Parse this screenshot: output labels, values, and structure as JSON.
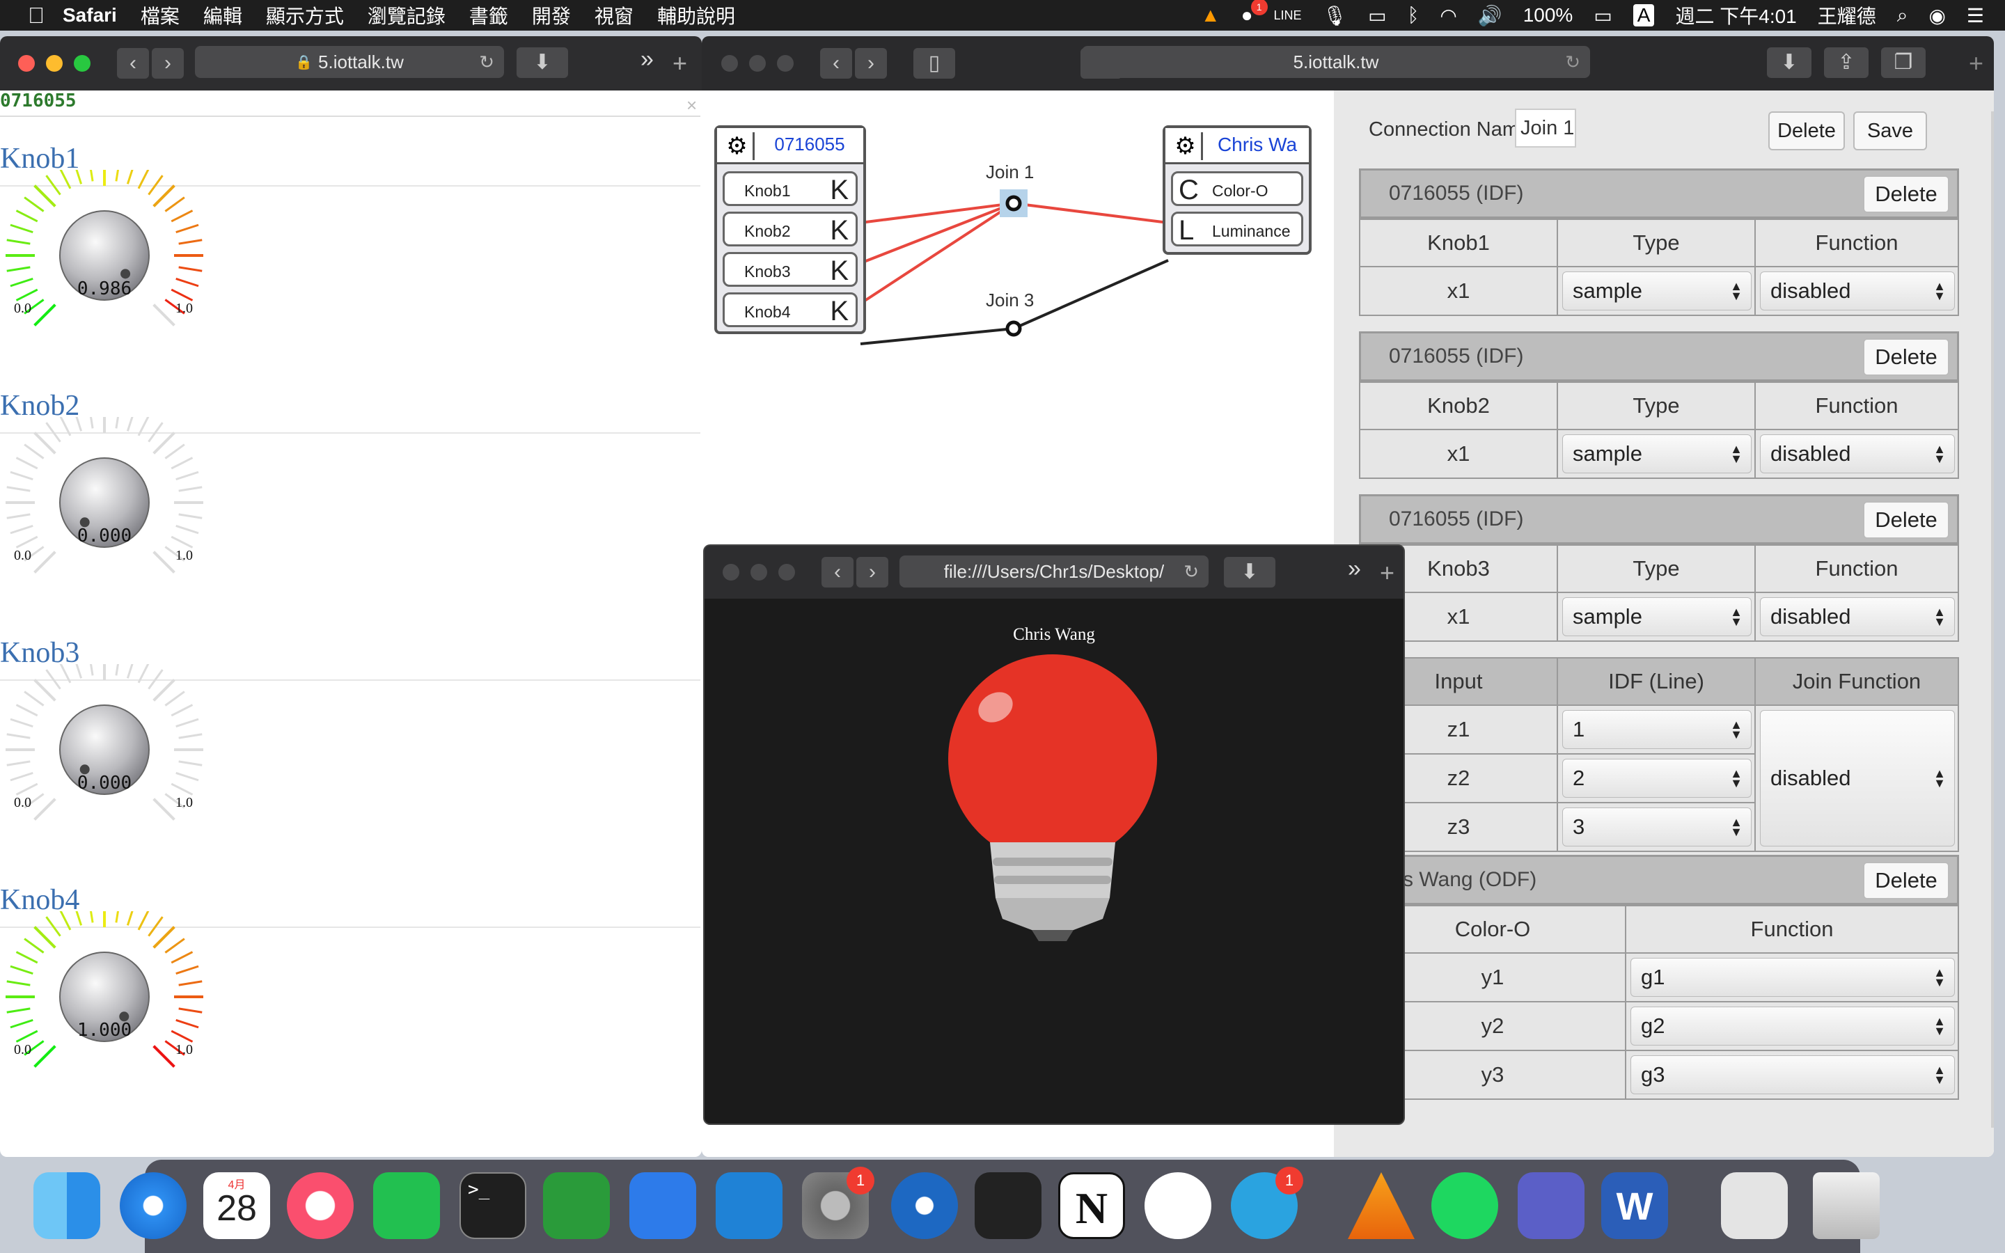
{
  "menubar": {
    "apple_icon": "apple-icon",
    "app_name": "Safari",
    "items": [
      "檔案",
      "編輯",
      "顯示方式",
      "瀏覽記錄",
      "書籤",
      "開發",
      "視窗",
      "輔助說明"
    ],
    "battery": "100%",
    "input_method": "A",
    "datetime": "週二 下午4:01",
    "user": "王耀德",
    "notification_badge": "1"
  },
  "left_window": {
    "url": "5.iottalk.tw",
    "device_name": "0716055",
    "close_symbol": "×",
    "knobs": [
      {
        "label": "Knob1",
        "value": "0.986",
        "level": 0.986,
        "min": "0.0",
        "max": "1.0"
      },
      {
        "label": "Knob2",
        "value": "0.000",
        "level": 0.0,
        "min": "0.0",
        "max": "1.0"
      },
      {
        "label": "Knob3",
        "value": "0.000",
        "level": 0.0,
        "min": "0.0",
        "max": "1.0"
      },
      {
        "label": "Knob4",
        "value": "1.000",
        "level": 1.0,
        "min": "0.0",
        "max": "1.0"
      }
    ]
  },
  "main_window": {
    "url": "5.iottalk.tw",
    "graph": {
      "idf_device": "0716055",
      "idf_features": [
        {
          "name": "Knob1",
          "letter": "K"
        },
        {
          "name": "Knob2",
          "letter": "K"
        },
        {
          "name": "Knob3",
          "letter": "K"
        },
        {
          "name": "Knob4",
          "letter": "K"
        }
      ],
      "odf_device": "Chris Wa",
      "odf_features": [
        {
          "name": "Color-O",
          "letter": "C"
        },
        {
          "name": "Luminance",
          "letter": "L"
        }
      ],
      "joins": [
        "Join 1",
        "Join 3"
      ],
      "colors": {
        "join1": "#e8473e",
        "join3": "#222222"
      }
    },
    "panel": {
      "connection_name_label": "Connection Name:",
      "connection_name_value": "Join 1",
      "delete_label": "Delete",
      "save_label": "Save",
      "idf_sections": [
        {
          "title": "0716055 (IDF)",
          "feature": "Knob1",
          "type_header": "Type",
          "function_header": "Function",
          "var": "x1",
          "type": "sample",
          "function": "disabled"
        },
        {
          "title": "0716055 (IDF)",
          "feature": "Knob2",
          "type_header": "Type",
          "function_header": "Function",
          "var": "x1",
          "type": "sample",
          "function": "disabled"
        },
        {
          "title": "0716055 (IDF)",
          "feature": "Knob3",
          "type_header": "Type",
          "function_header": "Function",
          "var": "x1",
          "type": "sample",
          "function": "disabled"
        }
      ],
      "join": {
        "headers": [
          "Input",
          "IDF (Line)",
          "Join Function"
        ],
        "rows": [
          {
            "input": "z1",
            "line": "1"
          },
          {
            "input": "z2",
            "line": "2"
          },
          {
            "input": "z3",
            "line": "3"
          }
        ],
        "function": "disabled"
      },
      "odf": {
        "title": "s Wang (ODF)",
        "feature_header": "Color-O",
        "function_header": "Function",
        "rows": [
          {
            "var": "y1",
            "function": "g1"
          },
          {
            "var": "y2",
            "function": "g2"
          },
          {
            "var": "y3",
            "function": "g3"
          }
        ]
      }
    }
  },
  "bulb_window": {
    "url": "file:///Users/Chr1s/Desktop/",
    "title": "Chris Wang",
    "bulb_color": "#e53326"
  },
  "dock": {
    "items": [
      "finder-icon",
      "safari-icon",
      "calendar-icon",
      "music-icon",
      "line-icon",
      "terminal-icon",
      "vim-icon",
      "xcode-icon",
      "vscode-icon",
      "system-preferences-icon",
      "voice-memos-icon",
      "piano-icon",
      "notion-icon",
      "slack-icon",
      "telegram-icon",
      "vlc-icon",
      "spotify-icon",
      "teams-icon",
      "word-icon",
      "documents-icon",
      "trash-icon"
    ],
    "calendar_month": "4月",
    "calendar_day": "28",
    "sysprefs_badge": "1",
    "telegram_badge": "1",
    "notion_letter": "N",
    "word_letter": "W",
    "terminal_prompt": ">_"
  }
}
